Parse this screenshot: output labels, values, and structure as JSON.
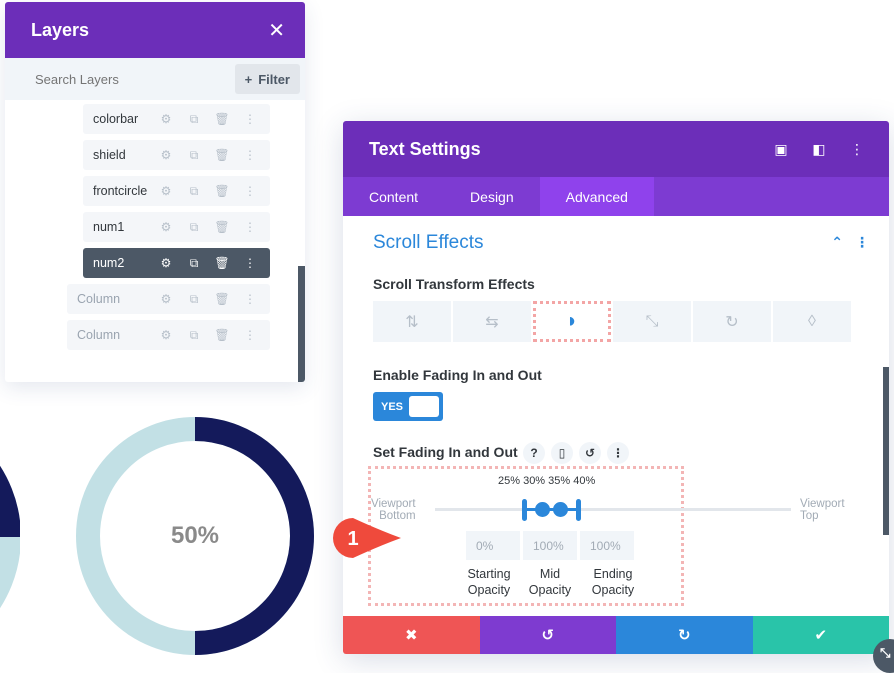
{
  "layers": {
    "title": "Layers",
    "search_placeholder": "Search Layers",
    "filter_label": "Filter",
    "items": [
      {
        "label": "colorbar",
        "state": "normal"
      },
      {
        "label": "shield",
        "state": "normal"
      },
      {
        "label": "frontcircle",
        "state": "normal"
      },
      {
        "label": "num1",
        "state": "normal"
      },
      {
        "label": "num2",
        "state": "active"
      },
      {
        "label": "Column",
        "state": "dim"
      },
      {
        "label": "Column",
        "state": "dim"
      }
    ]
  },
  "canvas": {
    "donut_value_label": "50%",
    "donut_percent": 50,
    "colors": {
      "filled": "#141a5b",
      "track": "#c2e0e5"
    }
  },
  "settings": {
    "title": "Text Settings",
    "tabs": [
      {
        "label": "Content",
        "active": false
      },
      {
        "label": "Design",
        "active": false
      },
      {
        "label": "Advanced",
        "active": true
      }
    ],
    "section_title": "Scroll Effects",
    "scroll_transform_label": "Scroll Transform Effects",
    "effects": [
      {
        "icon": "vertical-motion-icon",
        "glyph": "⇅",
        "active": false
      },
      {
        "icon": "horizontal-motion-icon",
        "glyph": "⇆",
        "active": false
      },
      {
        "icon": "fade-icon",
        "glyph": "◗",
        "active": true
      },
      {
        "icon": "scale-icon",
        "glyph": "⤡",
        "active": false
      },
      {
        "icon": "rotate-icon",
        "glyph": "↻",
        "active": false
      },
      {
        "icon": "blur-icon",
        "glyph": "💧",
        "active": false
      }
    ],
    "enable_fading_label": "Enable Fading In and Out",
    "toggle_label": "YES",
    "toggle_on": true,
    "set_fading_label": "Set Fading In and Out",
    "percent_labels": "25% 30% 35% 40%",
    "handles_percent": [
      25,
      30,
      35,
      40
    ],
    "viewport_bottom_label": "Viewport\nBottom",
    "viewport_top_line1": "Viewport",
    "viewport_top_line2": "Top",
    "viewport_bottom_line1": "Viewport",
    "viewport_bottom_line2": "Bottom",
    "opacity_inputs": [
      {
        "value": "0%",
        "label_1": "Starting",
        "label_2": "Opacity"
      },
      {
        "value": "100%",
        "label_1": "Mid",
        "label_2": "Opacity"
      },
      {
        "value": "100%",
        "label_1": "Ending",
        "label_2": "Opacity"
      }
    ],
    "footer": {
      "cancel": "✖",
      "undo": "↺",
      "redo": "↻",
      "save": "✔"
    }
  },
  "marker_number": "1",
  "colors": {
    "purple_header": "#6c2eb9",
    "tab_bar": "#7d3bd2",
    "tab_active": "#8f42ec",
    "accent_blue": "#2b87da",
    "cancel_red": "#ef5555",
    "save_green": "#29c4a9"
  }
}
